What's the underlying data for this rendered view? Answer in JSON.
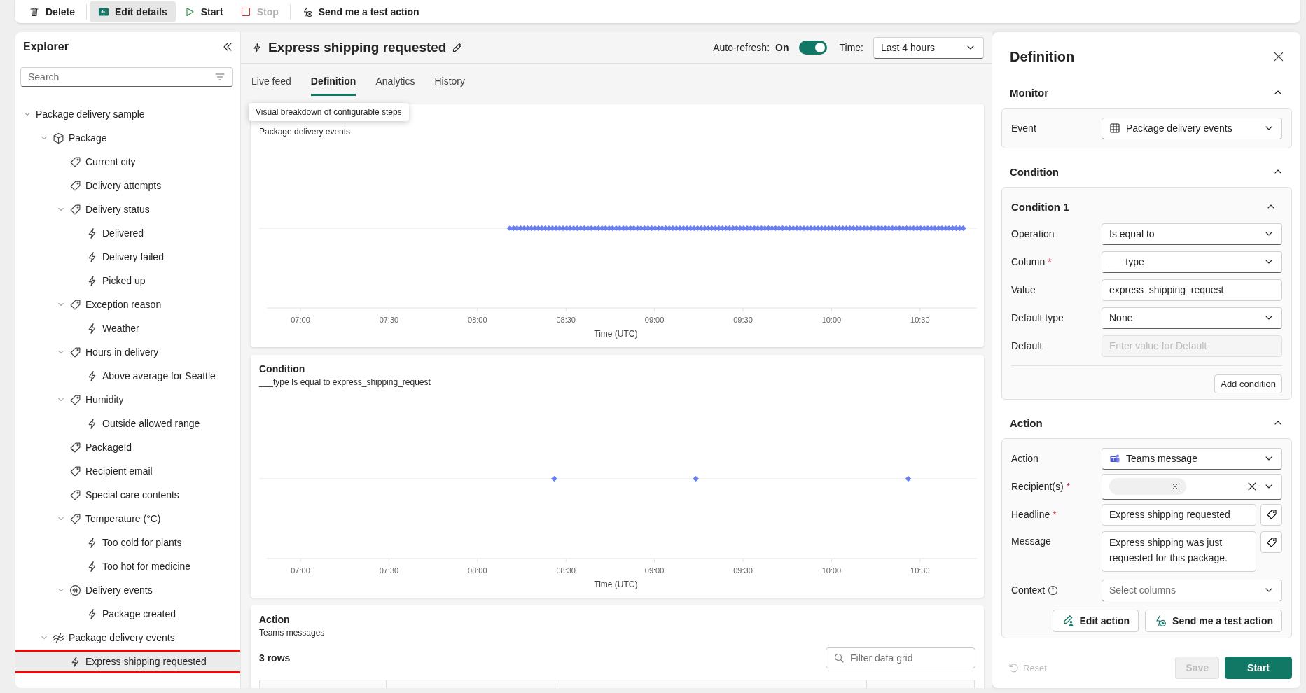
{
  "toolbar": {
    "groups": [
      [
        {
          "label": "Delete",
          "kind": "delete",
          "pressed": false,
          "disabled": false
        }
      ],
      [
        {
          "label": "Edit details",
          "kind": "edit-details",
          "pressed": true,
          "disabled": false
        },
        {
          "label": "Start",
          "kind": "start",
          "pressed": false,
          "disabled": false
        },
        {
          "label": "Stop",
          "kind": "stop",
          "pressed": false,
          "disabled": true
        }
      ],
      [
        {
          "label": "Send me a test action",
          "kind": "send-test",
          "pressed": false,
          "disabled": false
        }
      ]
    ]
  },
  "explorer": {
    "title": "Explorer",
    "search": {
      "placeholder": "Search"
    },
    "tree": [
      {
        "label": "Package delivery sample",
        "expanded": true,
        "selected": false,
        "children": [
          {
            "label": "Package",
            "kind": "object",
            "expanded": true,
            "selected": false,
            "children": [
              {
                "label": "Current city",
                "kind": "property",
                "selected": false
              },
              {
                "label": "Delivery attempts",
                "kind": "property",
                "selected": false
              },
              {
                "label": "Delivery status",
                "kind": "property",
                "expanded": true,
                "selected": false,
                "children": [
                  {
                    "label": "Delivered",
                    "kind": "rule",
                    "selected": false
                  },
                  {
                    "label": "Delivery failed",
                    "kind": "rule",
                    "selected": false
                  },
                  {
                    "label": "Picked up",
                    "kind": "rule",
                    "selected": false
                  }
                ]
              },
              {
                "label": "Exception reason",
                "kind": "property",
                "expanded": true,
                "selected": false,
                "children": [
                  {
                    "label": "Weather",
                    "kind": "rule",
                    "selected": false
                  }
                ]
              },
              {
                "label": "Hours in delivery",
                "kind": "property",
                "expanded": true,
                "selected": false,
                "children": [
                  {
                    "label": "Above average for Seattle",
                    "kind": "rule",
                    "selected": false
                  }
                ]
              },
              {
                "label": "Humidity",
                "kind": "property",
                "expanded": true,
                "selected": false,
                "children": [
                  {
                    "label": "Outside allowed range",
                    "kind": "rule",
                    "selected": false
                  }
                ]
              },
              {
                "label": "PackageId",
                "kind": "id-property",
                "selected": false
              },
              {
                "label": "Recipient email",
                "kind": "property",
                "selected": false
              },
              {
                "label": "Special care contents",
                "kind": "property",
                "selected": false
              },
              {
                "label": "Temperature (°C)",
                "kind": "property",
                "expanded": true,
                "selected": false,
                "children": [
                  {
                    "label": "Too cold for plants",
                    "kind": "rule",
                    "selected": false
                  },
                  {
                    "label": "Too hot for medicine",
                    "kind": "rule",
                    "selected": false
                  }
                ]
              },
              {
                "label": "Delivery events",
                "kind": "event",
                "expanded": true,
                "selected": false,
                "children": [
                  {
                    "label": "Package created",
                    "kind": "rule",
                    "selected": false
                  }
                ]
              }
            ]
          },
          {
            "label": "Package delivery events",
            "kind": "stream",
            "expanded": true,
            "selected": false,
            "children": [
              {
                "label": "Express shipping requested",
                "kind": "rule",
                "selected": true
              }
            ]
          }
        ]
      }
    ]
  },
  "header": {
    "title": "Express shipping requested",
    "auto_refresh": {
      "label": "Auto-refresh:",
      "value": "On",
      "on": true
    },
    "time": {
      "label": "Time:",
      "value": "Last 4 hours"
    }
  },
  "tabs": [
    {
      "label": "Live feed",
      "selected": false
    },
    {
      "label": "Definition",
      "selected": true
    },
    {
      "label": "Analytics",
      "selected": false
    },
    {
      "label": "History",
      "selected": false
    }
  ],
  "tooltip": "Visual breakdown of configurable steps",
  "cards": [
    {
      "kind": "dense-timeline",
      "subtitle": "Package delivery events",
      "x_axis": {
        "label": "Time (UTC)",
        "ticks": [
          "07:00",
          "07:30",
          "08:00",
          "08:30",
          "09:00",
          "09:30",
          "10:00",
          "10:30"
        ]
      }
    },
    {
      "kind": "sparse-timeline",
      "title": "Condition",
      "subtitle": "___type Is equal to express_shipping_request",
      "x_axis": {
        "label": "Time (UTC)",
        "ticks": [
          "07:00",
          "07:30",
          "08:00",
          "08:30",
          "09:00",
          "09:30",
          "10:00",
          "10:30"
        ]
      }
    },
    {
      "kind": "table",
      "title": "Action",
      "subtitle": "Teams messages",
      "row_count": "3 rows",
      "filter": {
        "placeholder": "Filter data grid"
      }
    }
  ],
  "definition_panel": {
    "title": "Definition",
    "sections": [
      {
        "title": "Monitor",
        "expanded": true,
        "box": {
          "fields": [
            {
              "label": "Event",
              "kind": "event-picker",
              "value": "Package delivery events"
            }
          ]
        }
      },
      {
        "title": "Condition",
        "expanded": true,
        "box": {
          "title": "Condition 1",
          "expanded": true,
          "fields": [
            {
              "label": "Operation",
              "kind": "dropdown",
              "value": "Is equal to",
              "disabled": false
            },
            {
              "label": "Column",
              "required_mark": "*",
              "kind": "dropdown",
              "value": "___type",
              "disabled": false
            },
            {
              "label": "Value",
              "kind": "input",
              "value": "express_shipping_request",
              "disabled": false
            },
            {
              "label": "Default type",
              "kind": "dropdown",
              "value": "None",
              "disabled": false
            },
            {
              "label": "Default",
              "kind": "input",
              "placeholder": "Enter value for Default",
              "disabled": true
            }
          ],
          "add_button": "Add condition"
        }
      },
      {
        "title": "Action",
        "expanded": true,
        "box": {
          "fields": [
            {
              "label": "Action",
              "kind": "action-picker",
              "value": "Teams message"
            },
            {
              "label": "Recipient(s)",
              "required_mark": "*",
              "kind": "recipients"
            },
            {
              "label": "Headline",
              "required_mark": "*",
              "kind": "input-tag",
              "value": "Express shipping requested"
            },
            {
              "label": "Message",
              "kind": "textarea-tag",
              "value": "Express shipping was just requested for this package."
            },
            {
              "label": "Context",
              "kind": "dropdown-info",
              "placeholder": "Select columns"
            }
          ],
          "buttons": [
            {
              "label": "Edit action",
              "kind": "edit"
            },
            {
              "label": "Send me a test action",
              "kind": "send-test"
            }
          ]
        }
      }
    ],
    "footer": {
      "reset": {
        "label": "Reset",
        "disabled": true
      },
      "buttons": [
        {
          "label": "Save",
          "kind": "secondary",
          "disabled": true
        },
        {
          "label": "Start",
          "kind": "primary",
          "disabled": false
        }
      ]
    }
  }
}
